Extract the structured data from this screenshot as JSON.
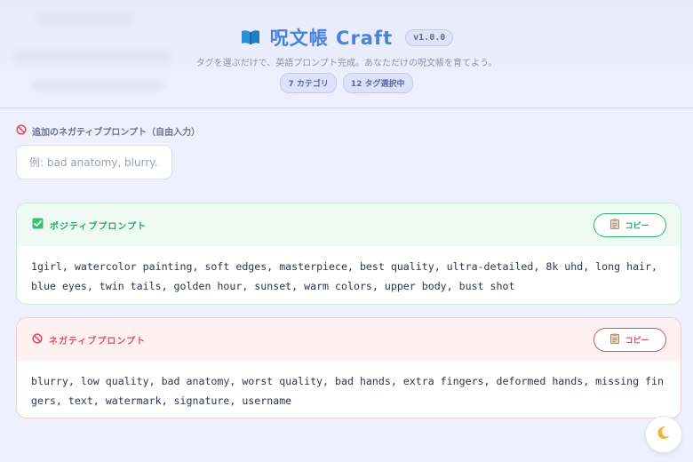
{
  "header": {
    "title": "呪文帳 Craft",
    "version": "v1.0.0",
    "subtitle": "タグを選ぶだけで、英語プロンプト完成。あなただけの呪文帳を育てよう。",
    "badges": [
      "7 カテゴリ",
      "12 タグ選択中"
    ]
  },
  "extra_negative": {
    "label": "追加のネガティブプロンプト（自由入力）",
    "placeholder": "例: bad anatomy, blurry..."
  },
  "positive": {
    "title": "ポジティブプロンプト",
    "copy_label": "コピー",
    "text": "1girl, watercolor painting, soft edges, masterpiece, best quality, ultra-detailed, 8k uhd, long hair, blue eyes, twin tails, golden hour, sunset, warm colors, upper body, bust shot"
  },
  "negative": {
    "title": "ネガティブプロンプト",
    "copy_label": "コピー",
    "text": "blurry, low quality, bad anatomy, worst quality, bad hands, extra fingers, deformed hands, missing fingers, text, watermark, signature, username"
  },
  "icons": {
    "title": "book-icon",
    "extra": "no-entry-icon",
    "positive": "check-icon",
    "negative": "no-entry-icon",
    "copy": "clipboard-icon",
    "theme": "moon-icon"
  },
  "colors": {
    "accent": "#4a82db",
    "positive": "#2fa56a",
    "negative": "#d8555c"
  }
}
